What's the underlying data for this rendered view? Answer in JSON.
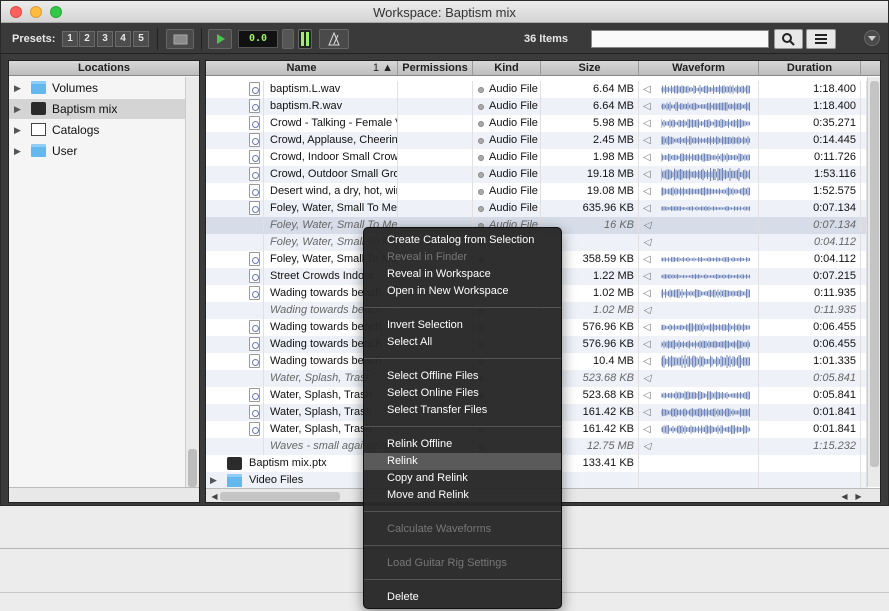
{
  "window": {
    "title": "Workspace: Baptism mix"
  },
  "toolbar": {
    "presets_label": "Presets:",
    "presets": [
      "1",
      "2",
      "3",
      "4",
      "5"
    ],
    "counter_value": "0.0",
    "items_count": "36 Items",
    "search_placeholder": ""
  },
  "locations": {
    "header": "Locations",
    "items": [
      {
        "label": "Volumes",
        "icon": "folder-icon"
      },
      {
        "label": "Baptism mix",
        "icon": "drive-icon"
      },
      {
        "label": "Catalogs",
        "icon": "catalog-icon"
      },
      {
        "label": "User",
        "icon": "folder-icon"
      }
    ]
  },
  "browser": {
    "columns": {
      "name": "Name",
      "sort": "1",
      "permissions": "Permissions",
      "kind": "Kind",
      "size": "Size",
      "waveform": "Waveform",
      "duration": "Duration"
    },
    "rows": [
      {
        "name": "baptism.L.wav",
        "kind": "Audio File",
        "size": "6.64 MB",
        "duration": "1:18.400",
        "offline": false
      },
      {
        "name": "baptism.R.wav",
        "kind": "Audio File",
        "size": "6.64 MB",
        "duration": "1:18.400",
        "offline": false
      },
      {
        "name": "Crowd - Talking - Female Voices",
        "kind": "Audio File",
        "size": "5.98 MB",
        "duration": "0:35.271",
        "offline": false
      },
      {
        "name": "Crowd, Applause, Cheering",
        "kind": "Audio File",
        "size": "2.45 MB",
        "duration": "0:14.445",
        "offline": false
      },
      {
        "name": "Crowd, Indoor Small Crowd",
        "kind": "Audio File",
        "size": "1.98 MB",
        "duration": "0:11.726",
        "offline": false
      },
      {
        "name": "Crowd, Outdoor Small Group",
        "kind": "Audio File",
        "size": "19.18 MB",
        "duration": "1:53.116",
        "offline": false
      },
      {
        "name": "Desert wind, a dry, hot, wind",
        "kind": "Audio File",
        "size": "19.08 MB",
        "duration": "1:52.575",
        "offline": false
      },
      {
        "name": "Foley, Water, Small To Medium",
        "kind": "Audio File",
        "size": "635.96 KB",
        "duration": "0:07.134",
        "offline": false
      },
      {
        "name": "Foley, Water, Small To Medium",
        "kind": "Audio File",
        "size": "16 KB",
        "duration": "0:07.134",
        "offline": true
      },
      {
        "name": "Foley, Water, Small To Medium",
        "kind": "",
        "size": "",
        "duration": "0:04.112",
        "offline": true
      },
      {
        "name": "Foley, Water, Small To Medium",
        "kind": "",
        "size": "358.59 KB",
        "duration": "0:04.112",
        "offline": false
      },
      {
        "name": "Street Crowds Indoor",
        "kind": "",
        "size": "1.22 MB",
        "duration": "0:07.215",
        "offline": false
      },
      {
        "name": "Wading towards beach",
        "kind": "",
        "size": "1.02 MB",
        "duration": "0:11.935",
        "offline": false
      },
      {
        "name": "Wading towards beach",
        "kind": "",
        "size": "1.02 MB",
        "duration": "0:11.935",
        "offline": true
      },
      {
        "name": "Wading towards beach",
        "kind": "",
        "size": "576.96 KB",
        "duration": "0:06.455",
        "offline": false
      },
      {
        "name": "Wading towards beach",
        "kind": "",
        "size": "576.96 KB",
        "duration": "0:06.455",
        "offline": false
      },
      {
        "name": "Wading towards beach",
        "kind": "",
        "size": "10.4 MB",
        "duration": "1:01.335",
        "offline": false
      },
      {
        "name": "Water, Splash, Trash",
        "kind": "",
        "size": "523.68 KB",
        "duration": "0:05.841",
        "offline": true
      },
      {
        "name": "Water, Splash, Trash",
        "kind": "",
        "size": "523.68 KB",
        "duration": "0:05.841",
        "offline": false
      },
      {
        "name": "Water, Splash, Trash",
        "kind": "",
        "size": "161.42 KB",
        "duration": "0:01.841",
        "offline": false
      },
      {
        "name": "Water, Splash, Trash",
        "kind": "",
        "size": "161.42 KB",
        "duration": "0:01.841",
        "offline": false
      },
      {
        "name": "Waves - small against rocks",
        "kind": "",
        "size": "12.75 MB",
        "duration": "1:15.232",
        "offline": true
      },
      {
        "name": "Baptism mix.ptx",
        "kind": "",
        "size": "133.41 KB",
        "duration": "",
        "offline": false
      },
      {
        "name": "Video Files",
        "kind": "",
        "size": "",
        "duration": "",
        "offline": false
      }
    ]
  },
  "context_menu": {
    "items": [
      {
        "label": "Create Catalog from Selection",
        "disabled": false
      },
      {
        "label": "Reveal in Finder",
        "disabled": true
      },
      {
        "label": "Reveal in Workspace",
        "disabled": false
      },
      {
        "label": "Open in New Workspace",
        "disabled": false
      },
      {
        "label": "Invert Selection",
        "disabled": false
      },
      {
        "label": "Select All",
        "disabled": false
      },
      {
        "label": "Select Offline Files",
        "disabled": false
      },
      {
        "label": "Select Online Files",
        "disabled": false
      },
      {
        "label": "Select Transfer Files",
        "disabled": false
      },
      {
        "label": "Relink Offline",
        "disabled": false
      },
      {
        "label": "Relink",
        "disabled": false,
        "highlighted": true
      },
      {
        "label": "Copy and Relink",
        "disabled": false
      },
      {
        "label": "Move and Relink",
        "disabled": false
      },
      {
        "label": "Calculate Waveforms",
        "disabled": true
      },
      {
        "label": "Load Guitar Rig Settings",
        "disabled": true
      },
      {
        "label": "Delete",
        "disabled": false
      }
    ]
  },
  "colors": {
    "window_bg": "#3b3b3b",
    "selection": "#d6dde9",
    "waveform": "#6f84b8",
    "menu_bg": "#282828",
    "menu_highlight": "#5a5a5a"
  }
}
